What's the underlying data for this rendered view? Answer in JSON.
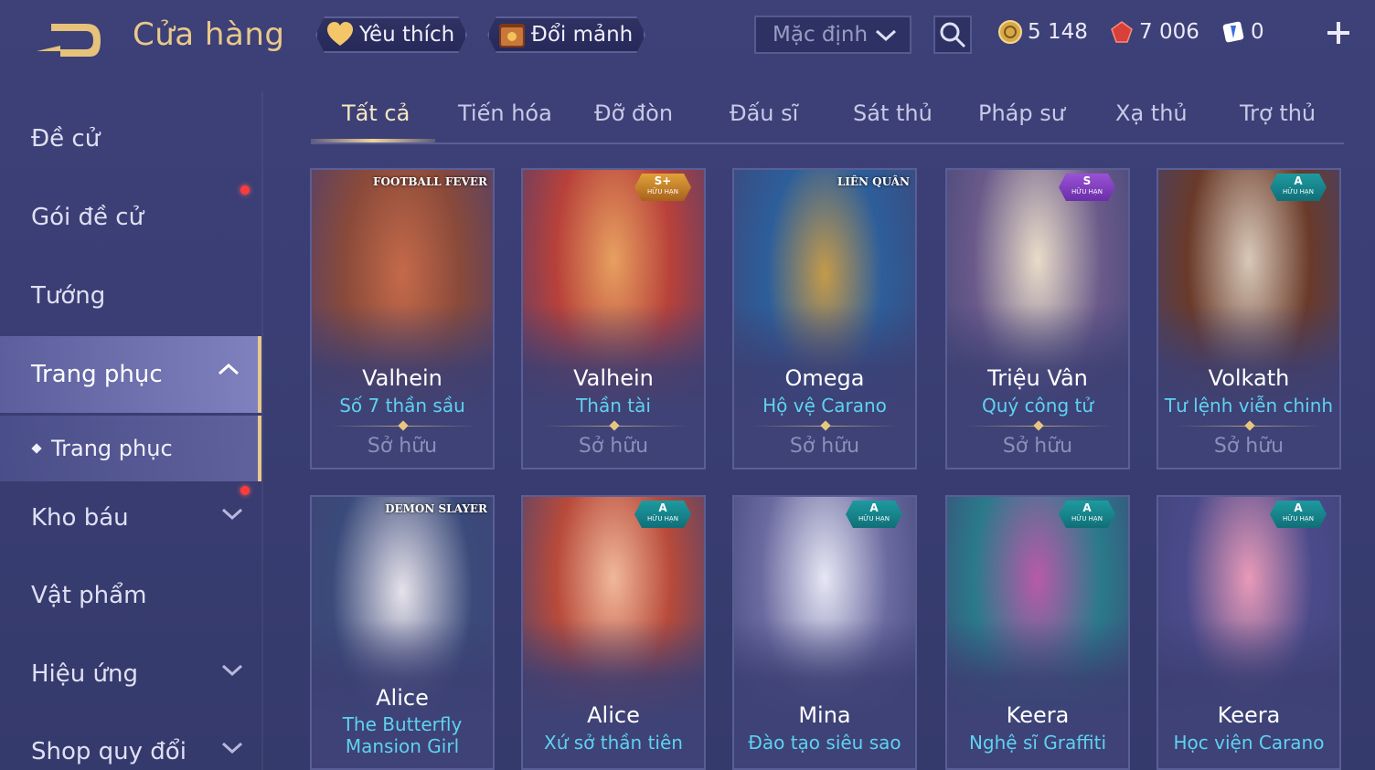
{
  "header": {
    "title": "Cửa hàng",
    "favorites_label": "Yêu thích",
    "exchange_label": "Đổi mảnh",
    "sort_selected": "Mặc định",
    "currencies": [
      {
        "name": "gold",
        "value": "5 148",
        "color": "#e8c062"
      },
      {
        "name": "quan-huy",
        "value": "7 006",
        "color": "#e0453c"
      },
      {
        "name": "voucher",
        "value": "0",
        "color": "#5fa0ff"
      }
    ]
  },
  "sidebar": {
    "items": [
      {
        "label": "Đề cử"
      },
      {
        "label": "Gói đề cử"
      },
      {
        "label": "Tướng"
      },
      {
        "label": "Trang phục"
      },
      {
        "label": "Kho báu"
      },
      {
        "label": "Vật phẩm"
      },
      {
        "label": "Hiệu ứng"
      },
      {
        "label": "Shop quy đổi"
      }
    ],
    "sub_item": "Trang phục"
  },
  "tabs": [
    "Tất cả",
    "Tiến hóa",
    "Đỡ đòn",
    "Đấu sĩ",
    "Sát thủ",
    "Pháp sư",
    "Xạ thủ",
    "Trợ thủ"
  ],
  "cards": [
    {
      "hero": "Valhein",
      "skin": "Số 7 thần sầu",
      "status": "Sở hữu",
      "tag": "FOOTBALL FEVER",
      "bg1": "#8a4a3a",
      "bg2": "#c56a4a"
    },
    {
      "hero": "Valhein",
      "skin": "Thần tài",
      "status": "Sở hữu",
      "tier": "S+",
      "limited": "HỮU HẠN",
      "bg1": "#b8413a",
      "bg2": "#e7a060"
    },
    {
      "hero": "Omega",
      "skin": "Hộ vệ Carano",
      "status": "Sở hữu",
      "tag": "LIÊN QUÂN",
      "bg1": "#2d5e9a",
      "bg2": "#c49a4a"
    },
    {
      "hero": "Triệu Vân",
      "skin": "Quý công tử",
      "status": "Sở hữu",
      "tier": "S",
      "limited": "HỮU HẠN",
      "bg1": "#6a5a8a",
      "bg2": "#e9dcc8"
    },
    {
      "hero": "Volkath",
      "skin": "Tư lệnh viễn chinh",
      "status": "Sở hữu",
      "tier": "A",
      "limited": "HỮU HẠN",
      "bg1": "#6a3a2a",
      "bg2": "#d8c8b8"
    },
    {
      "hero": "Alice",
      "skin": "The Butterfly Mansion Girl",
      "tag": "DEMON SLAYER",
      "bg1": "#3a4a7a",
      "bg2": "#e6e2ea"
    },
    {
      "hero": "Alice",
      "skin": "Xứ sở thần tiên",
      "tier": "A",
      "limited": "HỮU HẠN",
      "bg1": "#b84a3a",
      "bg2": "#f0b89a"
    },
    {
      "hero": "Mina",
      "skin": "Đào tạo siêu sao",
      "tier": "A",
      "limited": "HỮU HẠN",
      "bg1": "#6a6aa0",
      "bg2": "#e6e6f4"
    },
    {
      "hero": "Keera",
      "skin": "Nghệ sĩ Graffiti",
      "tier": "A",
      "limited": "HỮU HẠN",
      "bg1": "#2a7a8a",
      "bg2": "#b85aa8"
    },
    {
      "hero": "Keera",
      "skin": "Học viện Carano",
      "tier": "A",
      "limited": "HỮU HẠN",
      "bg1": "#4a4a8a",
      "bg2": "#e89ab8"
    }
  ]
}
